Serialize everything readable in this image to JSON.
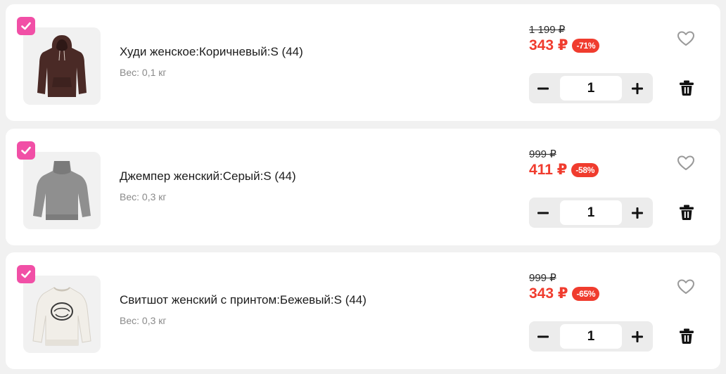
{
  "colors": {
    "accent_pink": "#f14fa6",
    "price_red": "#f03c2e",
    "background": "#f1f1f1"
  },
  "items": [
    {
      "title": "Худи женское:Коричневый:S (44)",
      "weight": "Вес: 0,1 кг",
      "old_price": "1 199 ₽",
      "price": "343 ₽",
      "discount": "-71%",
      "quantity": "1",
      "selected": true,
      "image": "brown-hoodie"
    },
    {
      "title": "Джемпер женский:Серый:S (44)",
      "weight": "Вес: 0,3 кг",
      "old_price": "999 ₽",
      "price": "411 ₽",
      "discount": "-58%",
      "quantity": "1",
      "selected": true,
      "image": "grey-turtleneck-sweater"
    },
    {
      "title": "Свитшот женский с принтом:Бежевый:S (44)",
      "weight": "Вес: 0,3 кг",
      "old_price": "999 ₽",
      "price": "343 ₽",
      "discount": "-65%",
      "quantity": "1",
      "selected": true,
      "image": "beige-print-sweatshirt"
    }
  ],
  "icons": {
    "checkbox": "checkmark-icon",
    "favorite": "heart-icon",
    "decrement": "minus-icon",
    "increment": "plus-icon",
    "remove": "trash-icon"
  }
}
